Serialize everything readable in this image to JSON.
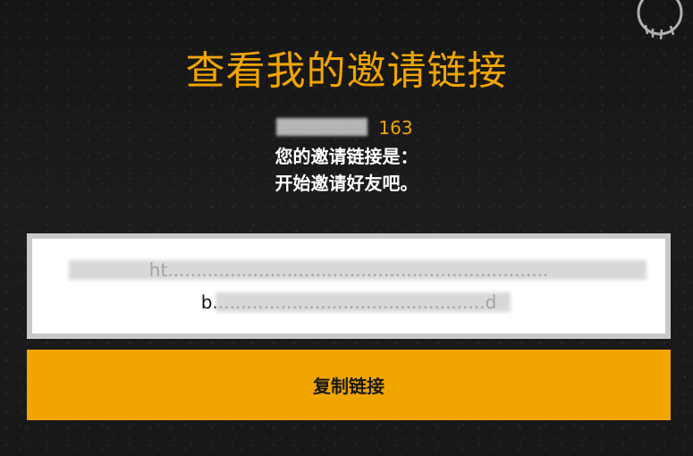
{
  "header": {
    "title": "查看我的邀请链接"
  },
  "user": {
    "name": "163"
  },
  "info": {
    "line1": "您的邀请链接是：",
    "line2": "开始邀请好友吧。"
  },
  "invite": {
    "link_text": "ht...................................................................b................................................d"
  },
  "actions": {
    "copy_label": "复制链接"
  },
  "colors": {
    "accent": "#f0a500",
    "background": "#1b1b1b",
    "text_on_dark": "#ffffff"
  },
  "icons": {
    "decoration": "graffiti-skull-icon"
  }
}
